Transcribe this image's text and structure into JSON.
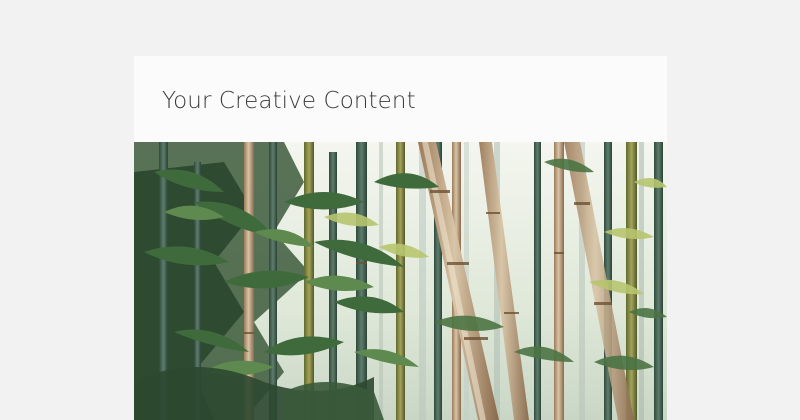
{
  "card": {
    "title": "Your Creative Content",
    "image_icon": "bamboo-forest-photo"
  },
  "colors": {
    "page_background": "#f2f2f2",
    "card_background": "#fbfbfb",
    "title_text": "#3a3a3a"
  }
}
